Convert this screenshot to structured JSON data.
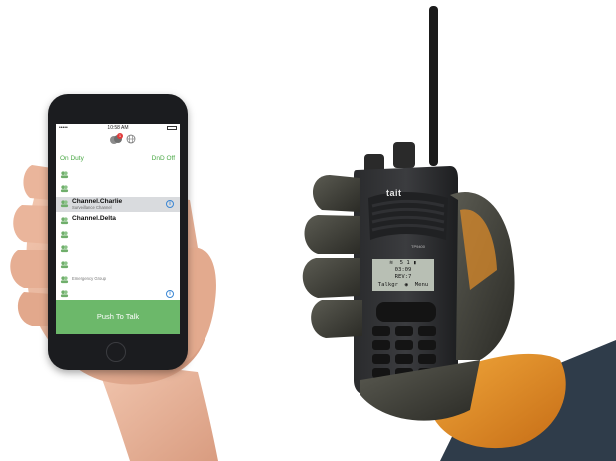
{
  "phone": {
    "status_time": "10:58 AM",
    "signal": "•••••",
    "badge_count": "1",
    "presence_left": "On Duty",
    "presence_right": "DnD Off",
    "channels": [
      {
        "name": "",
        "subtitle": "",
        "selected": false,
        "info": false
      },
      {
        "name": "",
        "subtitle": "",
        "selected": false,
        "info": false
      },
      {
        "name": "Channel.Charlie",
        "subtitle": "Surveillance Channel",
        "selected": true,
        "info": true
      },
      {
        "name": "Channel.Delta",
        "subtitle": "",
        "selected": false,
        "info": false
      },
      {
        "name": "",
        "subtitle": "",
        "selected": false,
        "info": false
      },
      {
        "name": "",
        "subtitle": "",
        "selected": false,
        "info": false
      },
      {
        "name": "",
        "subtitle": "",
        "selected": false,
        "info": false
      },
      {
        "name": "",
        "subtitle": "Emergency Group",
        "selected": false,
        "info": false
      },
      {
        "name": "",
        "subtitle": "",
        "selected": false,
        "info": true
      }
    ],
    "ptt_label": "Push To Talk",
    "accent_color": "#6cb86a",
    "presence_color": "#4aa845"
  },
  "radio": {
    "brand": "tait",
    "model": "TP9400",
    "display_lines": [
      "≋  5 1 ▮",
      "03:09",
      "REV:7",
      "Talkgr  ◉  Menu"
    ]
  }
}
